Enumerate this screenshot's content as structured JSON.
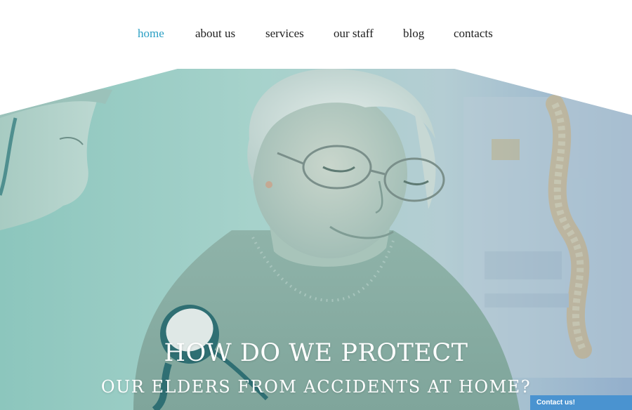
{
  "nav": {
    "items": [
      {
        "label": "home",
        "active": true
      },
      {
        "label": "about us",
        "active": false
      },
      {
        "label": "services",
        "active": false
      },
      {
        "label": "our staff",
        "active": false
      },
      {
        "label": "blog",
        "active": false
      },
      {
        "label": "contacts",
        "active": false
      }
    ],
    "active_color": "#2a9fc4",
    "text_color": "#1e1e1e"
  },
  "hero": {
    "title": "HOW DO WE PROTECT",
    "subtitle": "OUR ELDERS FROM ACCIDENTS AT HOME?",
    "overlay_color": "#8fc7c0"
  },
  "contact_tab": {
    "label": "Contact us!",
    "color": "#4a93d0"
  }
}
